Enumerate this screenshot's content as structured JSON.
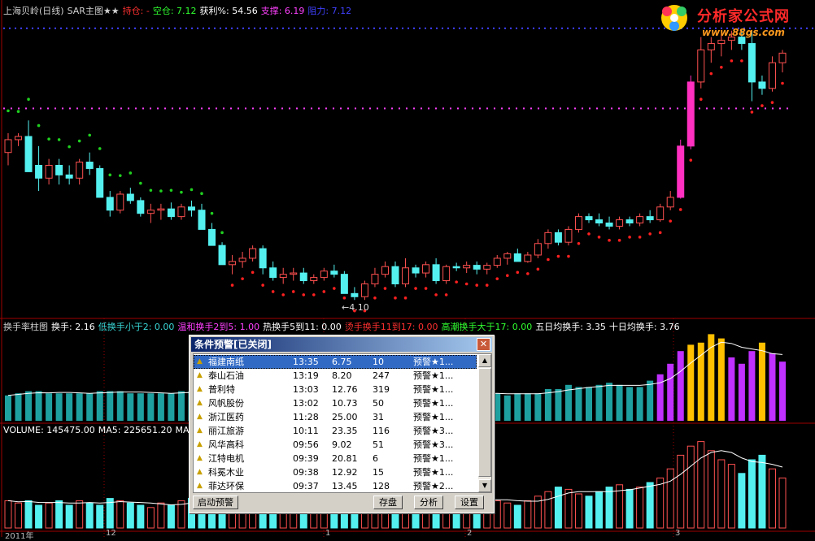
{
  "header": {
    "items": [
      {
        "text": "上海贝岭(日线)",
        "color": "#d0d0d0"
      },
      {
        "text": "SAR主图★★",
        "color": "#d0d0d0"
      },
      {
        "text": "持仓: -",
        "color": "#ff3030"
      },
      {
        "text": "空仓: 7.12",
        "color": "#30ff30"
      },
      {
        "text": "获利%: 54.56",
        "color": "#ffffff"
      },
      {
        "text": "支撑: 6.19",
        "color": "#ff40ff"
      },
      {
        "text": "阻力: 7.12",
        "color": "#4040ff"
      }
    ]
  },
  "turnover_header": {
    "items": [
      {
        "text": "换手率柱图",
        "color": "#d0d0d0"
      },
      {
        "text": "换手: 2.16",
        "color": "#ffffff"
      },
      {
        "text": "低换手小于2: 0.00",
        "color": "#3ad8d8"
      },
      {
        "text": "温和换手2到5: 1.00",
        "color": "#ff40ff"
      },
      {
        "text": "热换手5到11: 0.00",
        "color": "#ffffff"
      },
      {
        "text": "烫手换手11到17: 0.00",
        "color": "#ff3030"
      },
      {
        "text": "高潮换手大于17: 0.00",
        "color": "#30ff30"
      },
      {
        "text": "五日均换手: 3.35",
        "color": "#ffffff"
      },
      {
        "text": "十日均换手: 3.76",
        "color": "#ffffff"
      }
    ]
  },
  "volume_header": {
    "items": [
      {
        "text": "VOLUME: 145475.00",
        "color": "#ffffff"
      },
      {
        "text": "MA5: 225651.20",
        "color": "#ffffff"
      },
      {
        "text": "MA",
        "color": "#ffffff"
      }
    ]
  },
  "low_label": "←4.10",
  "x_labels": [
    "2011年",
    "12",
    "1",
    "2",
    "3"
  ],
  "logo": {
    "title": "分析家公式网",
    "url": "www.88gs.com"
  },
  "dialog": {
    "title": "条件预警[已关闭]",
    "close_icon": "close-icon",
    "rows": [
      {
        "name": "福建南纸",
        "time": "13:35",
        "price": "6.75",
        "qty": "10",
        "tag": "预警★1..."
      },
      {
        "name": "泰山石油",
        "time": "13:19",
        "price": "8.20",
        "qty": "247",
        "tag": "预警★1..."
      },
      {
        "name": "普利特",
        "time": "13:03",
        "price": "12.76",
        "qty": "319",
        "tag": "预警★1..."
      },
      {
        "name": "风帆股份",
        "time": "13:02",
        "price": "10.73",
        "qty": "50",
        "tag": "预警★1..."
      },
      {
        "name": "浙江医药",
        "time": "11:28",
        "price": "25.00",
        "qty": "31",
        "tag": "预警★1..."
      },
      {
        "name": "丽江旅游",
        "time": "10:11",
        "price": "23.35",
        "qty": "116",
        "tag": "预警★3..."
      },
      {
        "name": "风华高科",
        "time": "09:56",
        "price": "9.02",
        "qty": "51",
        "tag": "预警★3..."
      },
      {
        "name": "江特电机",
        "time": "09:39",
        "price": "20.81",
        "qty": "6",
        "tag": "预警★1..."
      },
      {
        "name": "科冕木业",
        "time": "09:38",
        "price": "12.92",
        "qty": "15",
        "tag": "预警★1..."
      },
      {
        "name": "菲达环保",
        "time": "09:37",
        "price": "13.45",
        "qty": "128",
        "tag": "预警★2..."
      }
    ],
    "buttons": {
      "start": "启动预警",
      "save": "存盘",
      "analyze": "分析",
      "settings": "设置"
    }
  },
  "colors": {
    "up_candle": "#ff5050",
    "down_candle": "#54f0f0",
    "sar_green": "#20d020",
    "sar_red": "#ff2020",
    "resist_line": "#4040ff",
    "support_line": "#ff40ff",
    "turnover_low": "#1fa0a0",
    "turnover_warm": "#c030ff",
    "turnover_hot": "#ffc000"
  },
  "chart_data": {
    "type": "candlestick",
    "candles": [
      [
        5.5,
        5.8,
        5.3,
        5.7
      ],
      [
        5.7,
        5.8,
        5.6,
        5.75
      ],
      [
        5.75,
        6.0,
        5.7,
        5.2
      ],
      [
        5.3,
        5.6,
        4.9,
        5.1
      ],
      [
        5.1,
        5.4,
        5.0,
        5.3
      ],
      [
        5.3,
        5.4,
        5.0,
        5.15
      ],
      [
        5.15,
        5.3,
        5.0,
        5.1
      ],
      [
        5.1,
        5.4,
        5.0,
        5.35
      ],
      [
        5.35,
        5.5,
        5.15,
        5.25
      ],
      [
        5.25,
        5.3,
        5.0,
        4.8
      ],
      [
        4.8,
        4.9,
        4.5,
        4.6
      ],
      [
        4.6,
        4.9,
        4.55,
        4.85
      ],
      [
        4.85,
        4.95,
        4.7,
        4.75
      ],
      [
        4.75,
        4.8,
        4.5,
        4.55
      ],
      [
        4.55,
        4.7,
        4.4,
        4.6
      ],
      [
        4.6,
        4.7,
        4.45,
        4.62
      ],
      [
        4.62,
        4.72,
        4.45,
        4.5
      ],
      [
        4.5,
        4.7,
        4.45,
        4.65
      ],
      [
        4.65,
        4.75,
        4.5,
        4.6
      ],
      [
        4.6,
        4.7,
        4.4,
        4.3
      ],
      [
        4.3,
        4.4,
        4.1,
        4.05
      ],
      [
        4.05,
        4.1,
        3.95,
        3.75
      ],
      [
        3.75,
        3.9,
        3.6,
        3.8
      ],
      [
        3.8,
        3.95,
        3.7,
        3.85
      ],
      [
        3.85,
        4.05,
        3.8,
        4.0
      ],
      [
        4.0,
        4.05,
        3.6,
        3.7
      ],
      [
        3.7,
        3.8,
        3.5,
        3.55
      ],
      [
        3.55,
        3.7,
        3.45,
        3.6
      ],
      [
        3.6,
        3.7,
        3.5,
        3.62
      ],
      [
        3.62,
        3.7,
        3.45,
        3.5
      ],
      [
        3.5,
        3.6,
        3.45,
        3.55
      ],
      [
        3.55,
        3.7,
        3.5,
        3.65
      ],
      [
        3.65,
        3.75,
        3.55,
        3.6
      ],
      [
        3.6,
        3.65,
        3.4,
        3.3
      ],
      [
        3.3,
        3.4,
        3.2,
        3.25
      ],
      [
        3.25,
        3.5,
        3.2,
        3.45
      ],
      [
        3.45,
        3.7,
        3.4,
        3.6
      ],
      [
        3.6,
        3.8,
        3.55,
        3.72
      ],
      [
        3.72,
        3.8,
        3.4,
        3.45
      ],
      [
        3.45,
        3.85,
        3.4,
        3.7
      ],
      [
        3.7,
        3.75,
        3.55,
        3.62
      ],
      [
        3.62,
        3.8,
        3.55,
        3.75
      ],
      [
        3.75,
        3.85,
        3.45,
        3.5
      ],
      [
        3.5,
        3.75,
        3.45,
        3.72
      ],
      [
        3.72,
        3.78,
        3.65,
        3.7
      ],
      [
        3.7,
        3.8,
        3.62,
        3.74
      ],
      [
        3.74,
        3.8,
        3.6,
        3.68
      ],
      [
        3.68,
        3.78,
        3.6,
        3.74
      ],
      [
        3.74,
        3.9,
        3.7,
        3.85
      ],
      [
        3.85,
        3.95,
        3.75,
        3.92
      ],
      [
        3.92,
        4.0,
        3.8,
        3.8
      ],
      [
        3.8,
        3.95,
        3.78,
        3.9
      ],
      [
        3.9,
        4.15,
        3.85,
        4.08
      ],
      [
        4.08,
        4.3,
        4.0,
        4.25
      ],
      [
        4.25,
        4.3,
        4.05,
        4.1
      ],
      [
        4.1,
        4.35,
        4.05,
        4.3
      ],
      [
        4.3,
        4.55,
        4.25,
        4.5
      ],
      [
        4.5,
        4.55,
        4.4,
        4.45
      ],
      [
        4.45,
        4.55,
        4.35,
        4.4
      ],
      [
        4.4,
        4.5,
        4.3,
        4.35
      ],
      [
        4.35,
        4.5,
        4.3,
        4.45
      ],
      [
        4.45,
        4.5,
        4.35,
        4.4
      ],
      [
        4.4,
        4.55,
        4.35,
        4.5
      ],
      [
        4.5,
        4.6,
        4.4,
        4.45
      ],
      [
        4.45,
        4.7,
        4.42,
        4.65
      ],
      [
        4.65,
        4.9,
        4.6,
        4.8
      ],
      [
        4.8,
        5.7,
        4.78,
        5.6
      ],
      [
        5.6,
        6.7,
        5.55,
        6.6
      ],
      [
        6.6,
        7.3,
        6.5,
        7.1
      ],
      [
        7.1,
        7.3,
        6.9,
        7.2
      ],
      [
        7.2,
        7.35,
        7.0,
        7.25
      ],
      [
        7.25,
        7.4,
        7.1,
        7.3
      ],
      [
        7.3,
        7.42,
        7.1,
        7.2
      ],
      [
        7.2,
        7.4,
        6.3,
        6.6
      ],
      [
        6.6,
        6.7,
        6.4,
        6.5
      ],
      [
        6.5,
        7.0,
        6.45,
        6.9
      ],
      [
        6.9,
        7.1,
        6.75,
        7.05
      ]
    ],
    "ylim": [
      3.0,
      7.6
    ],
    "turnover": [
      1.2,
      1.3,
      1.4,
      1.4,
      1.3,
      1.3,
      1.3,
      1.3,
      1.3,
      1.4,
      1.4,
      1.4,
      1.3,
      1.3,
      1.3,
      1.3,
      1.3,
      1.4,
      1.4,
      1.4,
      1.4,
      1.4,
      1.3,
      1.3,
      1.3,
      1.3,
      1.4,
      1.4,
      1.4,
      1.3,
      1.3,
      1.3,
      1.4,
      1.4,
      1.3,
      1.3,
      1.3,
      1.3,
      1.3,
      1.3,
      1.4,
      1.4,
      1.4,
      1.3,
      1.3,
      1.3,
      1.3,
      1.3,
      1.3,
      1.2,
      1.3,
      1.3,
      1.3,
      1.5,
      1.5,
      1.7,
      1.6,
      1.6,
      1.7,
      1.8,
      1.7,
      1.6,
      1.6,
      1.9,
      2.2,
      2.7,
      3.3,
      3.6,
      3.7,
      4.1,
      3.9,
      3.0,
      2.7,
      3.3,
      3.7,
      3.2,
      2.8
    ],
    "volume": [
      60,
      55,
      60,
      50,
      55,
      60,
      50,
      60,
      55,
      50,
      65,
      60,
      55,
      50,
      45,
      55,
      50,
      60,
      65,
      55,
      50,
      55,
      60,
      50,
      45,
      55,
      60,
      55,
      50,
      55,
      60,
      50,
      55,
      60,
      65,
      70,
      50,
      55,
      60,
      45,
      50,
      55,
      60,
      65,
      55,
      60,
      65,
      70,
      60,
      55,
      50,
      60,
      70,
      80,
      90,
      85,
      75,
      70,
      80,
      90,
      95,
      85,
      90,
      100,
      110,
      130,
      160,
      180,
      190,
      170,
      150,
      140,
      120,
      150,
      160,
      130,
      110
    ],
    "vol_max": 200
  }
}
